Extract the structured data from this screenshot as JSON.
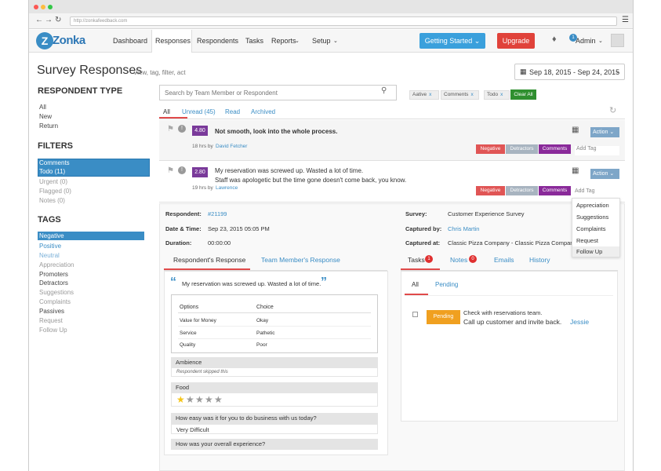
{
  "browser": {
    "url": "http://zonkafeedback.com"
  },
  "logo": {
    "text": "Zonka"
  },
  "nav": {
    "items": [
      "Dashboard",
      "Responses",
      "Respondents",
      "Tasks",
      "Reports",
      "Setup"
    ]
  },
  "header_buttons": {
    "getting_started": "Getting Started",
    "upgrade": "Upgrade",
    "admin": "Admin",
    "notification_count": "1"
  },
  "page": {
    "title": "Survey Responses",
    "subtitle": "View, tag, filter, act",
    "date_range": "Sep 18, 2015 - Sep 24, 2015"
  },
  "sidebar": {
    "respondent_type_heading": "RESPONDENT TYPE",
    "respondent_types": [
      "All",
      "New",
      "Return"
    ],
    "filters_heading": "FILTERS",
    "filters": [
      "Comments",
      "Todo (11)",
      "Urgent (0)",
      "Flagged (0)",
      "Notes (0)"
    ],
    "tags_heading": "TAGS",
    "tags": [
      "Negative",
      "Positive",
      "Neutral",
      "Appreciation",
      "Promoters",
      "Detractors",
      "Suggestions",
      "Complaints",
      "Passives",
      "Request",
      "Follow Up"
    ]
  },
  "search": {
    "placeholder": "Search by Team Member or Respondent"
  },
  "filter_chips": {
    "active": "Aative",
    "comments": "Comments",
    "todo": "Todo",
    "clear_all": "Clear All",
    "remove": "x"
  },
  "tabs": [
    "All",
    "Unread (45)",
    "Read",
    "Archived"
  ],
  "responses": [
    {
      "score": "4.80",
      "text": "Not smooth, look into the whole process.",
      "time": "18 hrs by",
      "author": "David Fetcher",
      "tags": [
        "Negative",
        "Detractors",
        "Comments"
      ],
      "add_tag": "Add Tag",
      "action": "Action"
    },
    {
      "score": "2.80",
      "text": "My reservation was screwed up. Wasted a lot of time.",
      "text2": "Staff was apologetic but the time gone doesn't come back, you know.",
      "time": "19 hrs by",
      "author": "Lawrence",
      "tags": [
        "Negative",
        "Detractors",
        "Comments"
      ],
      "add_tag": "Add Tag",
      "action": "Action"
    }
  ],
  "tag_menu": [
    "Appreciation",
    "Suggestions",
    "Complaints",
    "Request",
    "Follow Up"
  ],
  "detail": {
    "respondent_label": "Respondent:",
    "respondent": "#21199",
    "datetime_label": "Date & Time:",
    "datetime": "Sep 23, 2015 05:05 PM",
    "duration_label": "Duration:",
    "duration": "00:00:00",
    "survey_label": "Survey:",
    "survey": "Customer Experience Survey",
    "captured_by_label": "Captured by:",
    "captured_by": "Chris Martin",
    "captured_at_label": "Captured at:",
    "captured_at": "Classic Pizza Company - Classic Pizza Company"
  },
  "left_tabs": [
    "Respondent's Response",
    "Team Member's Response"
  ],
  "quote": "My reservation was screwed up. Wasted a lot of time.",
  "options_table": {
    "headers": [
      "Options",
      "Choice"
    ],
    "rows": [
      [
        "Value for Money",
        "Okay"
      ],
      [
        "Service",
        "Pathetic"
      ],
      [
        "Quality",
        "Poor"
      ]
    ]
  },
  "questions": [
    {
      "q": "Ambience",
      "a": "Respondent skipped this"
    },
    {
      "q": "Food",
      "a": ""
    },
    {
      "q": "How easy was it for you to do business with us today?",
      "a": "Very Difficult"
    },
    {
      "q": "How was your overall experience?",
      "a": ""
    }
  ],
  "rating": {
    "value": 1,
    "max": 5
  },
  "right_tabs": {
    "tasks": "Tasks",
    "tasks_count": "1",
    "notes": "Notes",
    "notes_count": "0",
    "emails": "Emails",
    "history": "History"
  },
  "task_tabs": [
    "All",
    "Pending"
  ],
  "task": {
    "status": "Pending",
    "line1": "Check with reservations team.",
    "line2": "Call up customer and invite back.",
    "assignee": "Jessie"
  },
  "colors": {
    "accent": "#3a8dc5",
    "purple": "#7a3a9a",
    "red": "#e04a4a",
    "green": "#3a9a3a",
    "orange": "#f0a020"
  }
}
